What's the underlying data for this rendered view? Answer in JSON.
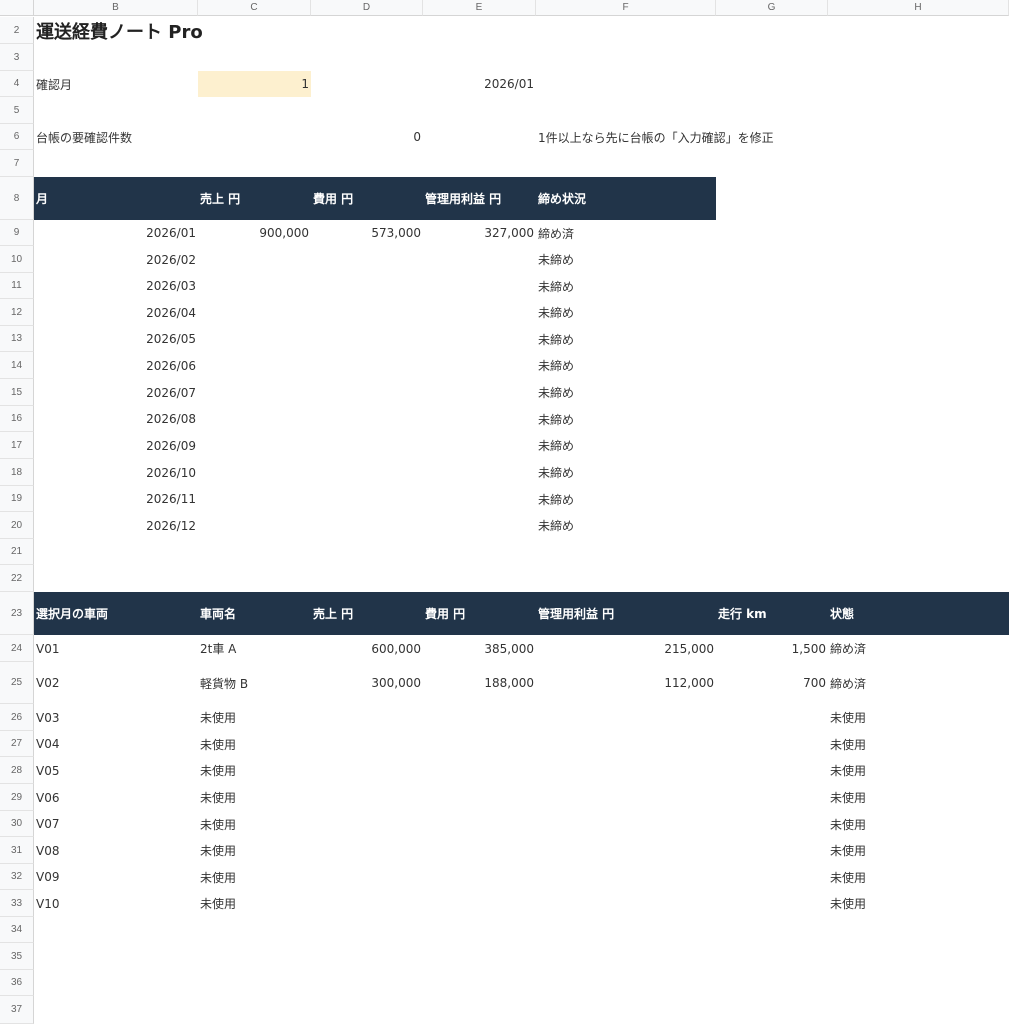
{
  "columns": [
    "B",
    "C",
    "D",
    "E",
    "F",
    "G",
    "H"
  ],
  "title": "運送経費ノート Pro",
  "check_month": {
    "label": "確認月",
    "value": "1",
    "display": "2026/01"
  },
  "ledger_check": {
    "label": "台帳の要確認件数",
    "value": "0",
    "note": "1件以上なら先に台帳の「入力確認」を修正"
  },
  "monthly_table": {
    "headers": [
      "月",
      "売上 円",
      "費用 円",
      "管理用利益 円",
      "締め状況"
    ],
    "rows": [
      [
        "2026/01",
        "900,000",
        "573,000",
        "327,000",
        "締め済"
      ],
      [
        "2026/02",
        "",
        "",
        "",
        "未締め"
      ],
      [
        "2026/03",
        "",
        "",
        "",
        "未締め"
      ],
      [
        "2026/04",
        "",
        "",
        "",
        "未締め"
      ],
      [
        "2026/05",
        "",
        "",
        "",
        "未締め"
      ],
      [
        "2026/06",
        "",
        "",
        "",
        "未締め"
      ],
      [
        "2026/07",
        "",
        "",
        "",
        "未締め"
      ],
      [
        "2026/08",
        "",
        "",
        "",
        "未締め"
      ],
      [
        "2026/09",
        "",
        "",
        "",
        "未締め"
      ],
      [
        "2026/10",
        "",
        "",
        "",
        "未締め"
      ],
      [
        "2026/11",
        "",
        "",
        "",
        "未締め"
      ],
      [
        "2026/12",
        "",
        "",
        "",
        "未締め"
      ]
    ]
  },
  "vehicle_table": {
    "headers": [
      "選択月の車両",
      "車両名",
      "売上 円",
      "費用 円",
      "管理用利益 円",
      "走行 km",
      "状態"
    ],
    "rows": [
      [
        "V01",
        "2t車 A",
        "600,000",
        "385,000",
        "215,000",
        "1,500",
        "締め済"
      ],
      [
        "V02",
        "軽貨物 B",
        "300,000",
        "188,000",
        "112,000",
        "700",
        "締め済"
      ],
      [
        "V03",
        "未使用",
        "",
        "",
        "",
        "",
        "未使用"
      ],
      [
        "V04",
        "未使用",
        "",
        "",
        "",
        "",
        "未使用"
      ],
      [
        "V05",
        "未使用",
        "",
        "",
        "",
        "",
        "未使用"
      ],
      [
        "V06",
        "未使用",
        "",
        "",
        "",
        "",
        "未使用"
      ],
      [
        "V07",
        "未使用",
        "",
        "",
        "",
        "",
        "未使用"
      ],
      [
        "V08",
        "未使用",
        "",
        "",
        "",
        "",
        "未使用"
      ],
      [
        "V09",
        "未使用",
        "",
        "",
        "",
        "",
        "未使用"
      ],
      [
        "V10",
        "未使用",
        "",
        "",
        "",
        "",
        "未使用"
      ]
    ]
  },
  "colors": {
    "header_band": "#213449",
    "input_fill": "#fdf0cf"
  }
}
